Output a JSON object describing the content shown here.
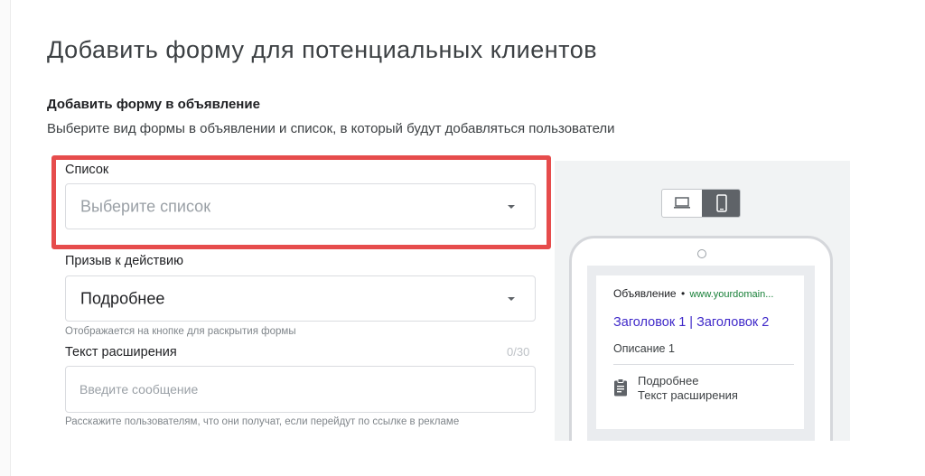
{
  "page": {
    "title": "Добавить форму для потенциальных клиентов"
  },
  "section": {
    "title": "Добавить форму в объявление",
    "description": "Выберите вид формы в объявлении и список, в который будут добавляться пользователи"
  },
  "form": {
    "list": {
      "label": "Список",
      "placeholder": "Выберите список"
    },
    "cta": {
      "label": "Призыв к действию",
      "value": "Подробнее",
      "hint": "Отображается на кнопке для раскрытия формы"
    },
    "extension_text": {
      "label": "Текст расширения",
      "counter": "0/30",
      "placeholder": "Введите сообщение",
      "value": "",
      "hint": "Расскажите пользователям, что они получат, если перейдут по ссылке в рекламе"
    }
  },
  "preview": {
    "devices": [
      {
        "name": "desktop",
        "icon": "laptop-icon",
        "selected": false
      },
      {
        "name": "mobile",
        "icon": "smartphone-icon",
        "selected": true
      }
    ],
    "ad": {
      "label": "Объявление",
      "separator": "•",
      "url": "www.yourdomain...",
      "headline": "Заголовок 1 | Заголовок 2",
      "description": "Описание 1",
      "extension_cta": "Подробнее",
      "extension_text": "Текст расширения",
      "extension_icon": "clipboard-icon"
    }
  },
  "colors": {
    "highlight": "#e64c4c",
    "headline_link": "#3f29c9",
    "url_green": "#188038",
    "selected_toggle": "#5f6368"
  }
}
